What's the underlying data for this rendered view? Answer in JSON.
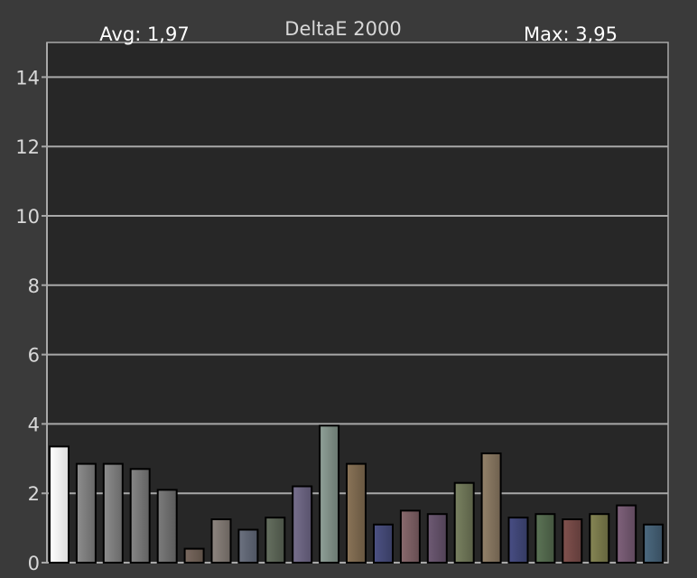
{
  "chart_data": {
    "type": "bar",
    "title": "DeltaE 2000",
    "annotations": {
      "avg": "Avg: 1,97",
      "max": "Max: 3,95"
    },
    "xlabel": "",
    "ylabel": "",
    "ylim": [
      0,
      15
    ],
    "yticks": [
      0,
      2,
      4,
      6,
      8,
      10,
      12,
      14
    ],
    "grid": true,
    "colors": {
      "page": "#3a3a3a",
      "plot": "#272727",
      "grid": "#a8a8a8",
      "text": "#d8d8d8",
      "annotation": "#ffffff"
    },
    "values": [
      3.35,
      2.85,
      2.85,
      2.7,
      2.1,
      0.4,
      1.25,
      0.95,
      1.3,
      2.2,
      3.95,
      2.85,
      1.1,
      1.5,
      1.4,
      2.3,
      3.15,
      1.3,
      1.4,
      1.25,
      1.4,
      1.65,
      1.1
    ],
    "bar_colors": [
      [
        "#ffffff",
        "#dcdcdc"
      ],
      [
        "#8e8e8e",
        "#686868"
      ],
      [
        "#8e8e8e",
        "#686868"
      ],
      [
        "#868686",
        "#626262"
      ],
      [
        "#7c7c7c",
        "#5a5a5a"
      ],
      [
        "#7a6a60",
        "#5c4f46"
      ],
      [
        "#8e8680",
        "#6a635e"
      ],
      [
        "#6c7280",
        "#4e5462"
      ],
      [
        "#667060",
        "#4a5246"
      ],
      [
        "#78708e",
        "#58526c"
      ],
      [
        "#90a098",
        "#6a7870"
      ],
      [
        "#8a7458",
        "#675640"
      ],
      [
        "#4c5284",
        "#383c62"
      ],
      [
        "#8a6a6e",
        "#664e52"
      ],
      [
        "#6e5a74",
        "#514256"
      ],
      [
        "#7a8262",
        "#5a6046"
      ],
      [
        "#94826a",
        "#6e604e"
      ],
      [
        "#484e84",
        "#343a62"
      ],
      [
        "#5c7456",
        "#44563f"
      ],
      [
        "#82524e",
        "#603c3a"
      ],
      [
        "#868654",
        "#64643e"
      ],
      [
        "#80627c",
        "#5e485c"
      ],
      [
        "#4c6a80",
        "#384e60"
      ]
    ]
  }
}
